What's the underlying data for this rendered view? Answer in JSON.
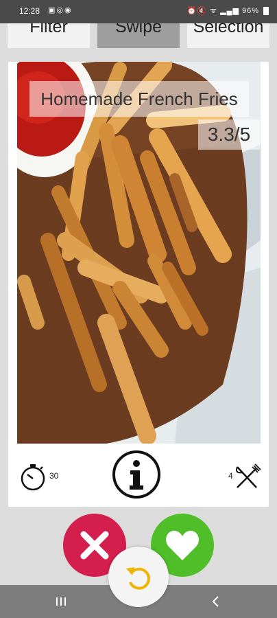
{
  "status_bar": {
    "time": "12:28",
    "notification_icons": [
      "image-icon",
      "messenger-icon",
      "whatsapp-icon"
    ],
    "system_icons": [
      "alarm-icon",
      "mute-icon",
      "wifi-icon",
      "signal-icon"
    ],
    "battery": "96%"
  },
  "tabs": [
    {
      "label": "Filter",
      "active": false
    },
    {
      "label": "Swipe",
      "active": true
    },
    {
      "label": "Selection",
      "active": false
    }
  ],
  "recipe": {
    "title": "Homemade French Fries",
    "rating": "3.3/5",
    "cook_time": "30",
    "servings": "4"
  },
  "colors": {
    "dislike": "#d31e4e",
    "like": "#4fbe29",
    "undo": "#f0b400"
  }
}
